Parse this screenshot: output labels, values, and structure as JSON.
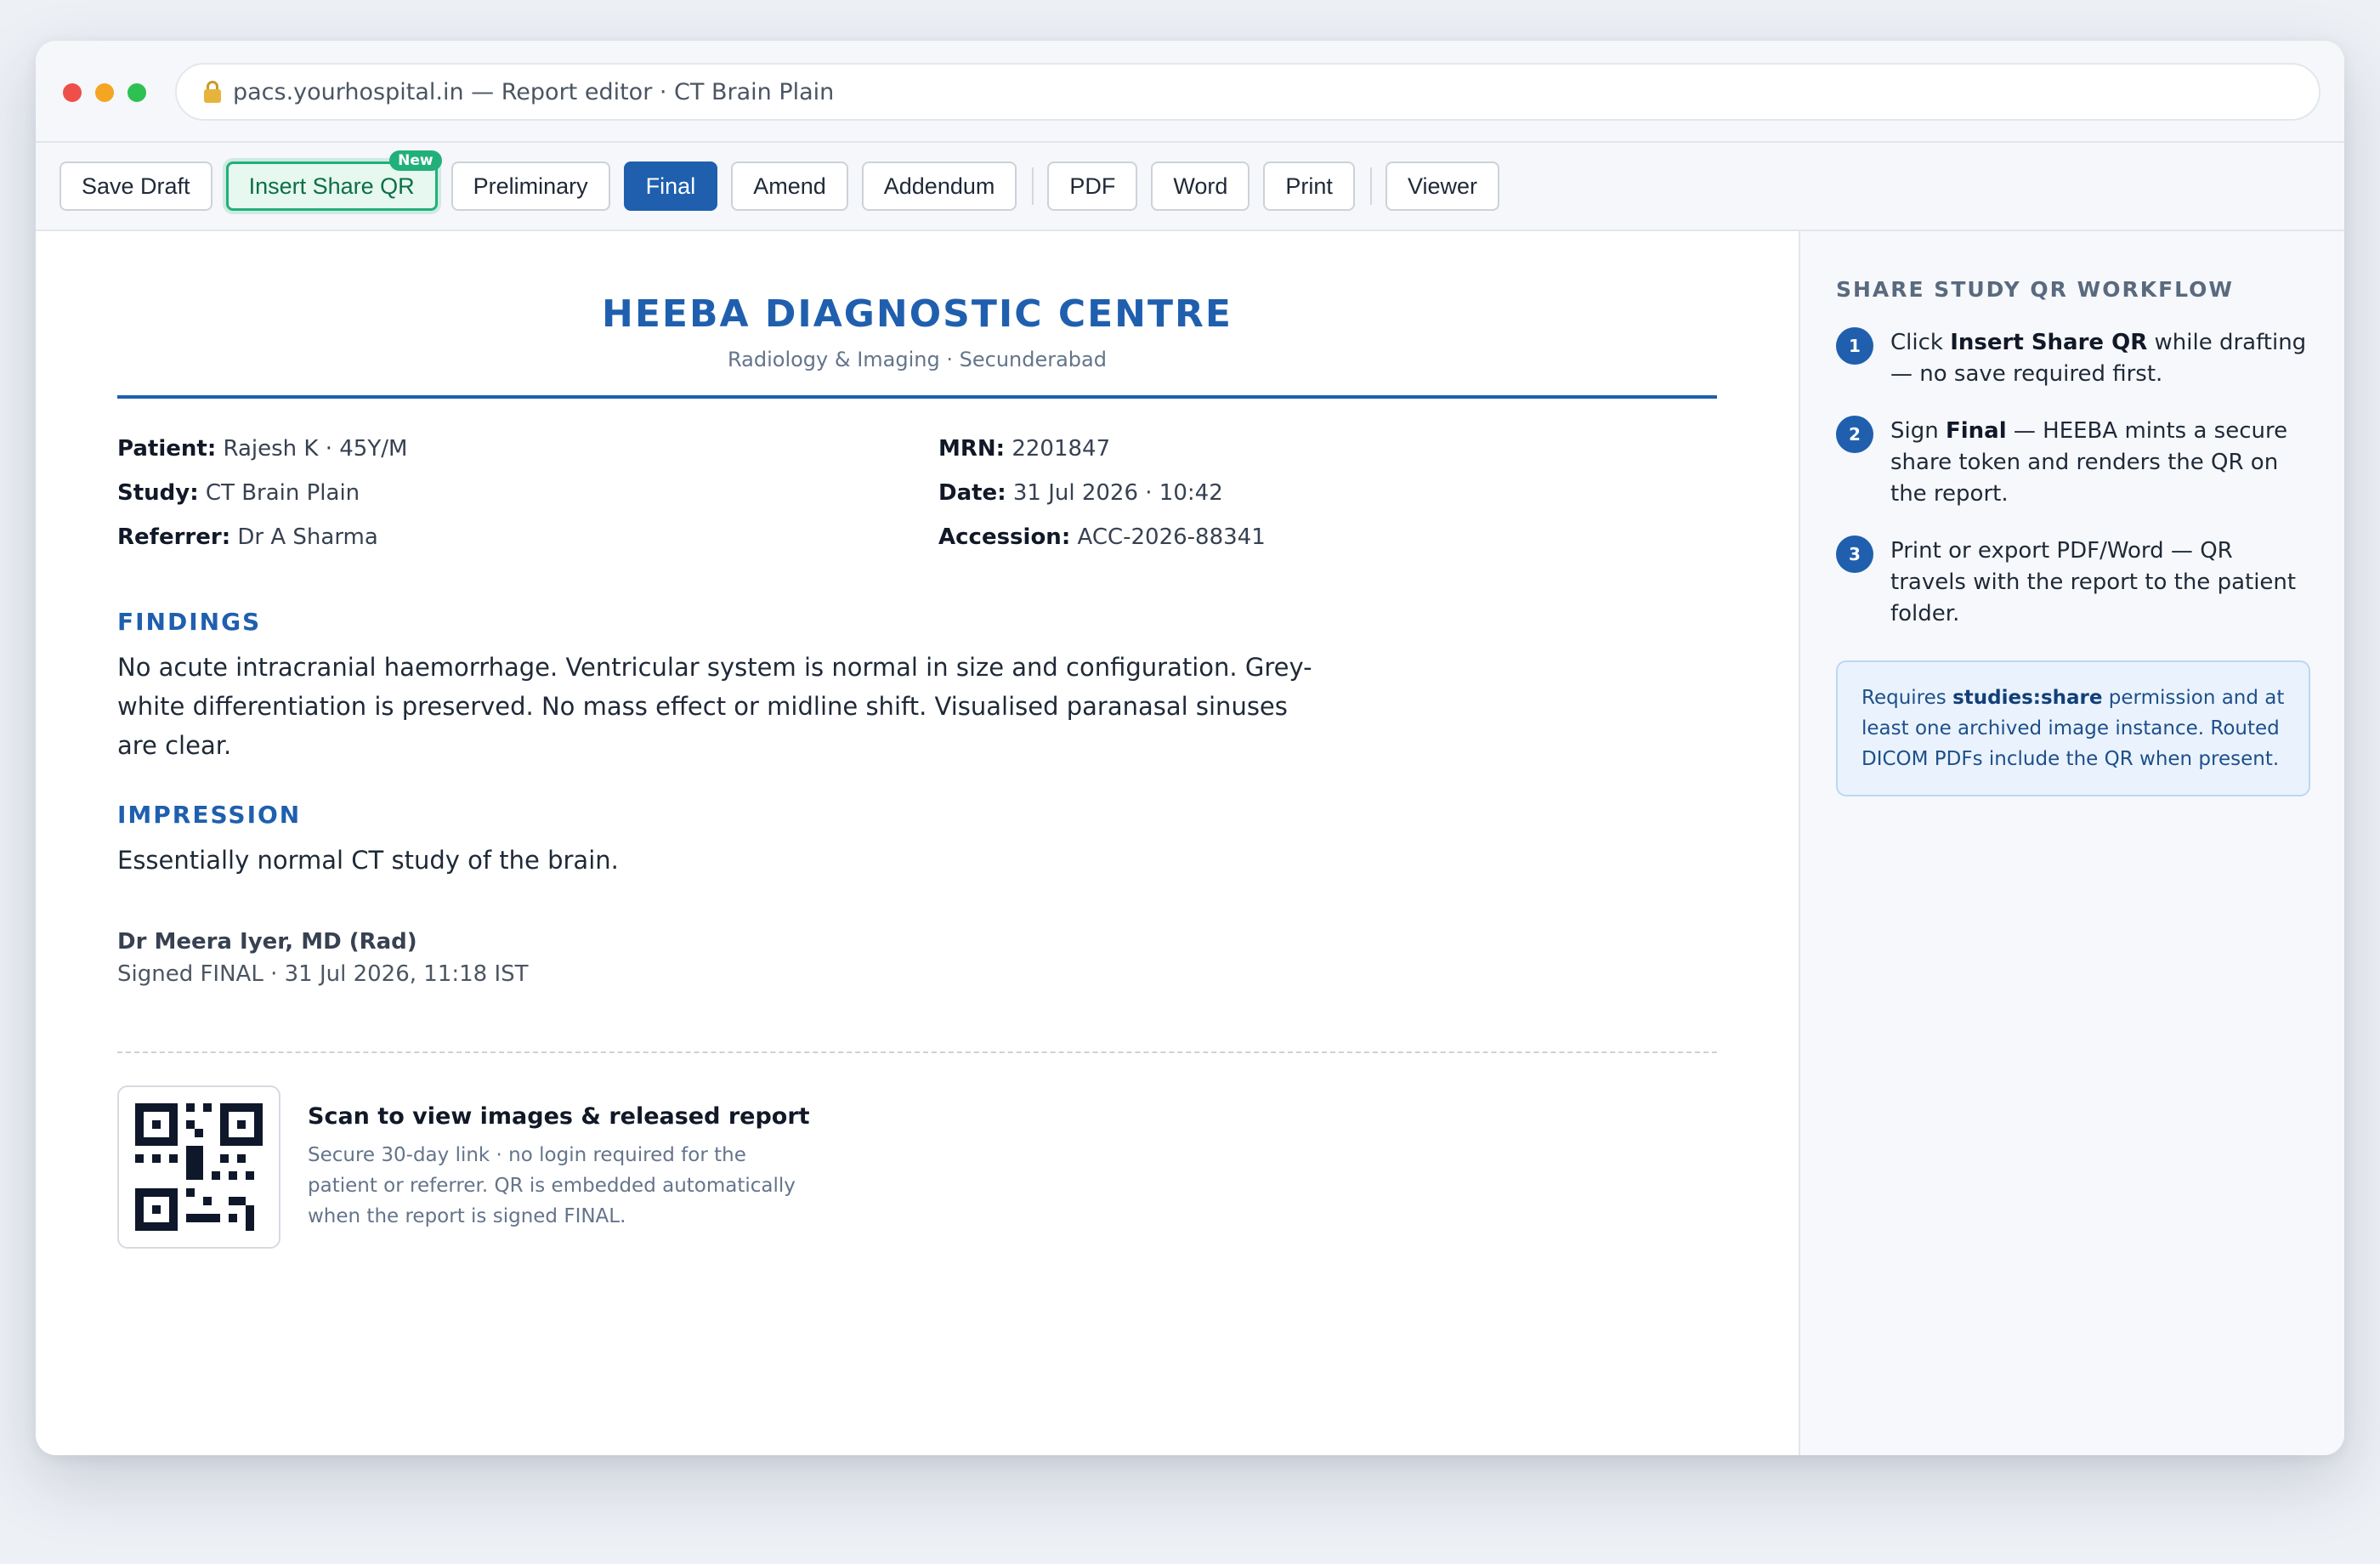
{
  "window": {
    "url_text": "pacs.yourhospital.in — Report editor · CT Brain Plain"
  },
  "toolbar": {
    "save_draft": "Save Draft",
    "insert_share_qr": "Insert Share QR",
    "new_badge": "New",
    "preliminary": "Preliminary",
    "final": "Final",
    "amend": "Amend",
    "addendum": "Addendum",
    "pdf": "PDF",
    "word": "Word",
    "print": "Print",
    "viewer": "Viewer"
  },
  "report": {
    "clinic_name": "HEEBA DIAGNOSTIC CENTRE",
    "clinic_sub": "Radiology & Imaging · Secunderabad",
    "patient_label": "Patient:",
    "patient_value": "Rajesh K · 45Y/M",
    "mrn_label": "MRN:",
    "mrn_value": "2201847",
    "study_label": "Study:",
    "study_value": "CT Brain Plain",
    "date_label": "Date:",
    "date_value": "31 Jul 2026 · 10:42",
    "referrer_label": "Referrer:",
    "referrer_value": "Dr A Sharma",
    "accession_label": "Accession:",
    "accession_value": "ACC-2026-88341",
    "findings_title": "FINDINGS",
    "findings_text": "No acute intracranial haemorrhage. Ventricular system is normal in size and configuration. Grey-white differentiation is preserved. No mass effect or midline shift. Visualised paranasal sinuses are clear.",
    "impression_title": "IMPRESSION",
    "impression_text": "Essentially normal CT study of the brain.",
    "signer_name": "Dr Meera Iyer, MD (Rad)",
    "signer_line": "Signed FINAL · 31 Jul 2026, 11:18 IST",
    "qr_title": "Scan to view images & released report",
    "qr_desc": "Secure 30-day link · no login required for the patient or referrer. QR is embedded automatically when the report is signed FINAL."
  },
  "side": {
    "title": "SHARE STUDY QR WORKFLOW",
    "steps": [
      {
        "num": "1",
        "pre": "Click ",
        "bold": "Insert Share QR",
        "post": " while drafting — no save required first."
      },
      {
        "num": "2",
        "pre": "Sign ",
        "bold": "Final",
        "post": " — HEEBA mints a secure share token and renders the QR on the report."
      },
      {
        "num": "3",
        "pre": "Print or export PDF/Word — QR travels with the report to the patient folder.",
        "bold": "",
        "post": ""
      }
    ],
    "note_pre": "Requires ",
    "note_bold": "studies:share",
    "note_post": " permission and at least one archived image instance. Routed DICOM PDFs include the QR when present."
  },
  "colors": {
    "accent": "#1f5fae",
    "qr_green": "#22b07a",
    "window_close": "#ef4f4a",
    "window_minimize": "#f4a521",
    "window_zoom": "#2fc052"
  }
}
